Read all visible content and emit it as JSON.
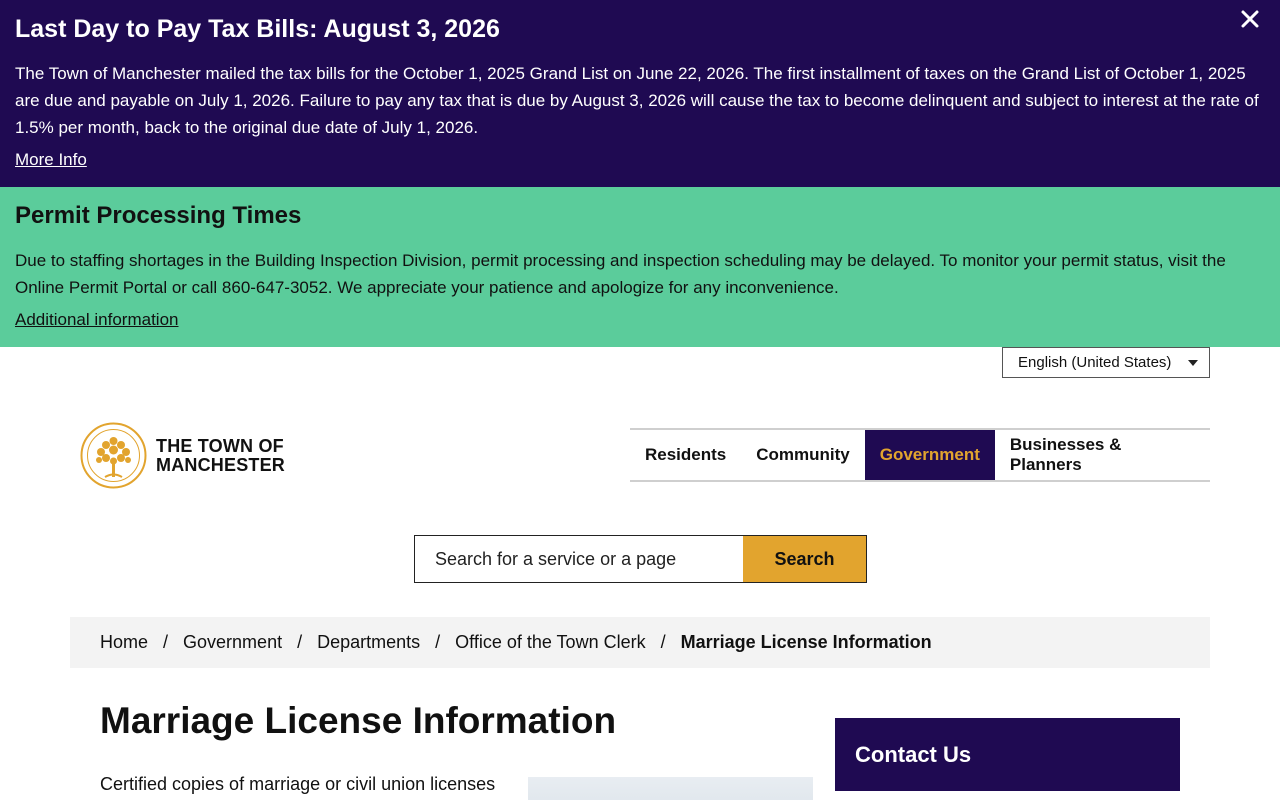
{
  "tax_alert": {
    "title": "Last Day to Pay Tax Bills: August 3, 2026",
    "body": "The Town of Manchester mailed the tax bills for the October 1, 2025 Grand List on June 22, 2026. The first installment of taxes on the Grand List of October 1, 2025 are due and payable on July 1, 2026. Failure to pay any tax that is due by August 3, 2026 will cause the tax to become delinquent and subject to interest at the rate of 1.5% per month, back to the original due date of July 1, 2026.",
    "link": "More Info",
    "close_icon": "close-icon"
  },
  "permit_alert": {
    "title": "Permit Processing Times",
    "body": "Due to staffing shortages in the Building Inspection Division, permit processing and inspection scheduling may be delayed. To monitor your permit status, visit the Online Permit Portal or call 860-647-3052. We appreciate your patience and apologize for any inconvenience.",
    "link": "Additional information"
  },
  "language": {
    "selected": "English (United States)"
  },
  "logo": {
    "line1": "THE TOWN OF",
    "line2": "MANCHESTER"
  },
  "nav": {
    "items": [
      {
        "label": "Residents"
      },
      {
        "label": "Community"
      },
      {
        "label": "Government"
      },
      {
        "label": "Businesses & Planners"
      }
    ],
    "active": "Government"
  },
  "search": {
    "placeholder": "Search for a service or a page",
    "button": "Search"
  },
  "breadcrumb": {
    "items": [
      "Home",
      "Government",
      "Departments",
      "Office of the Town Clerk"
    ],
    "current": "Marriage License Information",
    "separator": "/"
  },
  "main": {
    "title": "Marriage License Information",
    "intro": "Certified copies of marriage or civil union licenses"
  },
  "sidebar": {
    "contact_title": "Contact Us"
  },
  "colors": {
    "brand_purple": "#1f0a52",
    "accent_gold": "#e2a42e",
    "alert_green": "#5bcc9b"
  }
}
